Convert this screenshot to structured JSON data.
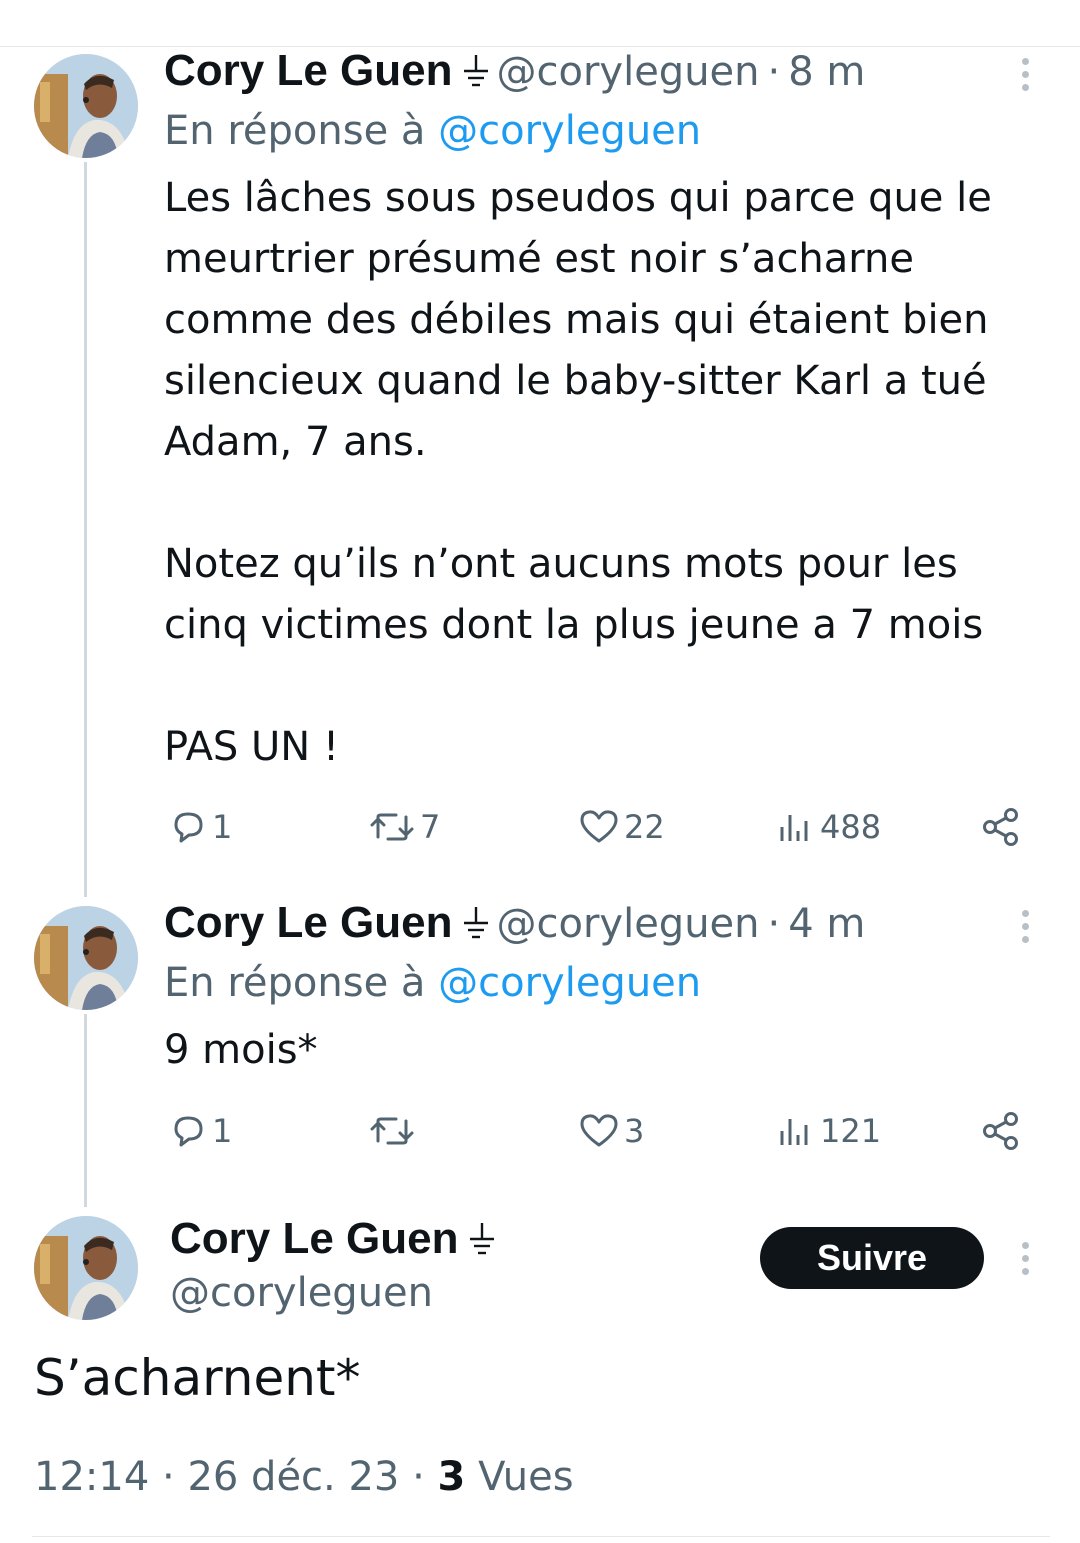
{
  "tweets": [
    {
      "name": "Cory Le Guen",
      "handle": "@coryleguen",
      "time": "8 m",
      "reply_prefix": "En réponse à",
      "reply_handle": "@coryleguen",
      "paragraphs": [
        "Les lâches sous pseudos qui parce que le meurtrier présumé est noir s’acharne comme des débiles mais qui étaient bien silencieux quand le baby-sitter Karl a tué Adam, 7 ans.",
        "Notez qu’ils n’ont aucuns mots pour les cinq victimes dont la plus jeune a 7 mois",
        "PAS UN !"
      ],
      "stats": {
        "replies": "1",
        "retweets": "7",
        "likes": "22",
        "views": "488"
      }
    },
    {
      "name": "Cory Le Guen",
      "handle": "@coryleguen",
      "time": "4 m",
      "reply_prefix": "En réponse à",
      "reply_handle": "@coryleguen",
      "paragraphs": [
        "9 mois*"
      ],
      "stats": {
        "replies": "1",
        "retweets": "",
        "likes": "3",
        "views": "121"
      }
    }
  ],
  "main_tweet": {
    "name": "Cory Le Guen",
    "handle": "@coryleguen",
    "follow_label": "Suivre",
    "text": "S’acharnent*",
    "time": "12:14",
    "date": "26 déc. 23",
    "views_count": "3",
    "views_label": "Vues"
  },
  "separator": "·",
  "icons": {
    "badge": "ground-symbol-icon",
    "reply": "reply-icon",
    "retweet": "retweet-icon",
    "like": "heart-icon",
    "views": "views-icon",
    "share": "share-icon",
    "more": "more-icon"
  },
  "colors": {
    "accent": "#1d9bf0",
    "text": "#0f1419",
    "secondary": "#536471",
    "button": "#0f1419"
  }
}
